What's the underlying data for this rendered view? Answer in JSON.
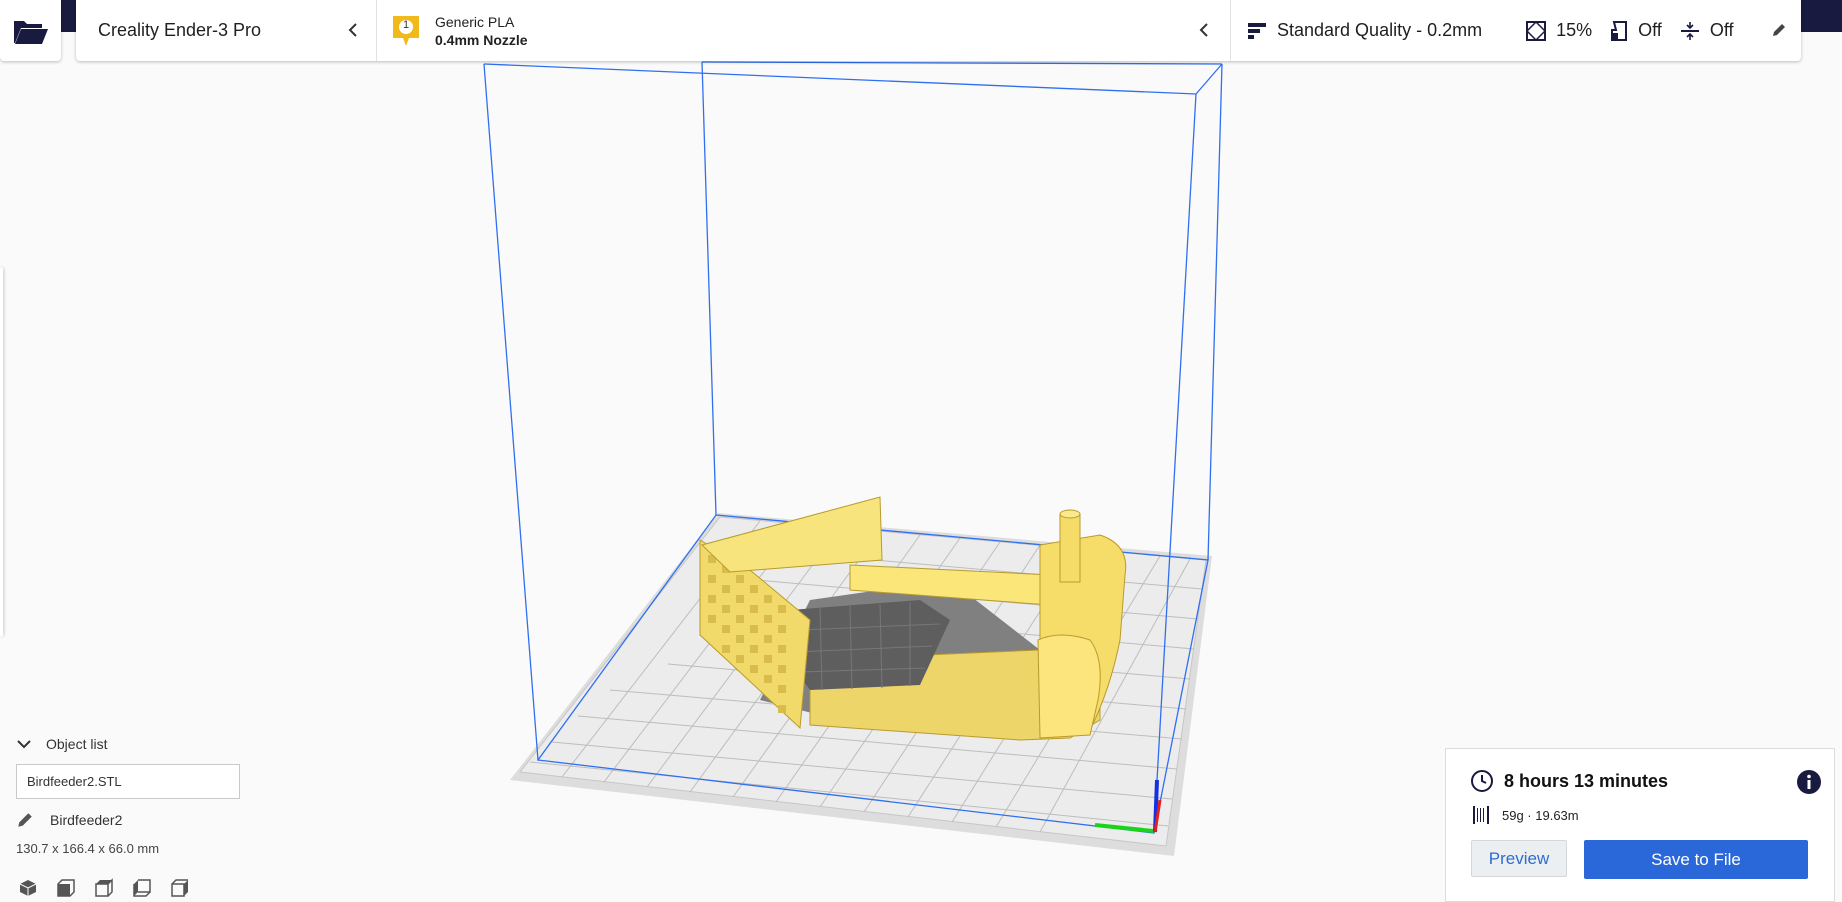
{
  "header": {
    "printer": "Creality Ender-3 Pro",
    "material": {
      "badge": "1",
      "name": "Generic PLA",
      "nozzle": "0.4mm Nozzle"
    },
    "quality": {
      "profile": "Standard Quality - 0.2mm",
      "infill": "15%",
      "support": "Off",
      "adhesion": "Off"
    }
  },
  "object_panel": {
    "title": "Object list",
    "file": "Birdfeeder2.STL",
    "object_name": "Birdfeeder2",
    "dimensions": "130.7 x 166.4 x 66.0 mm"
  },
  "print_panel": {
    "time": "8 hours 13 minutes",
    "material_usage": "59g · 19.63m",
    "preview_label": "Preview",
    "save_label": "Save to File"
  },
  "colors": {
    "accent": "#2a67d8",
    "topbar": "#191a3f",
    "model": "#f7e06a",
    "build_volume": "#2f6ff0"
  }
}
